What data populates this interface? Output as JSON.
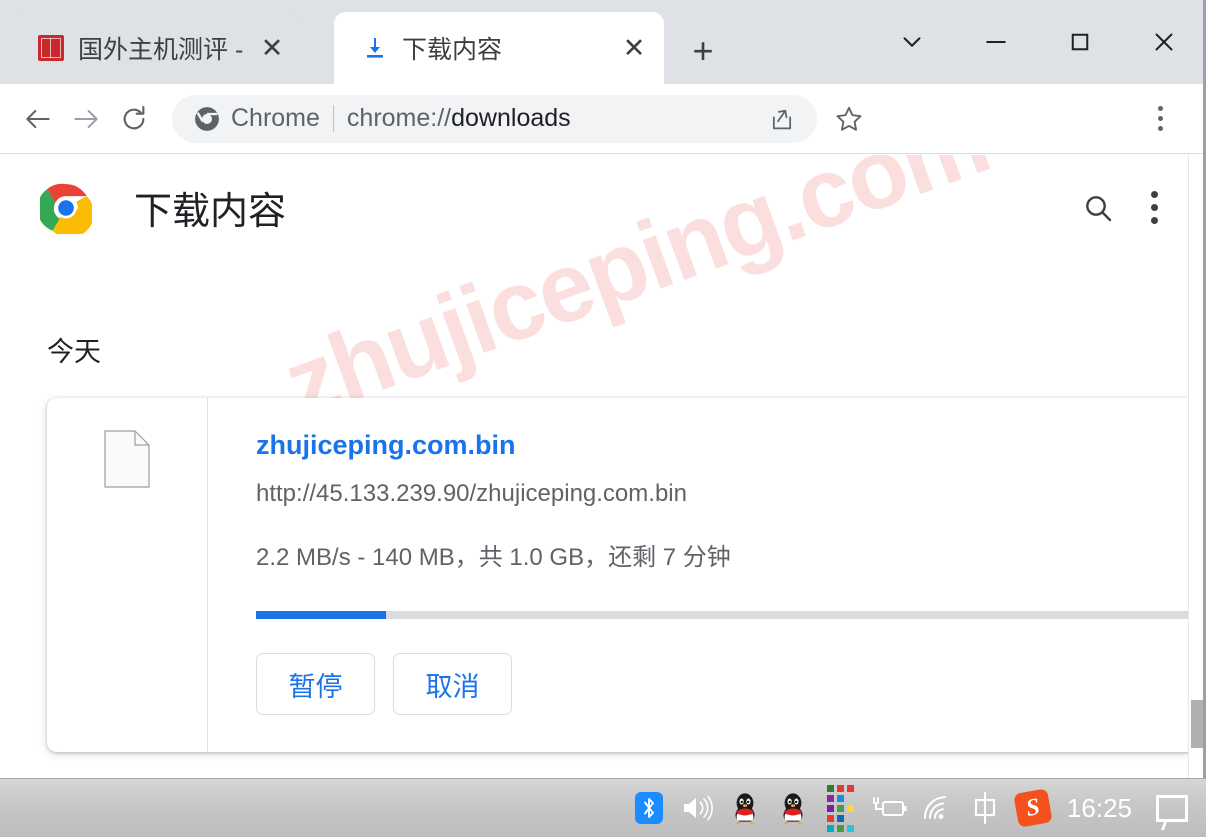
{
  "window": {
    "controls": [
      {
        "name": "tab-search",
        "glyph": "chevron-down"
      },
      {
        "name": "minimize",
        "glyph": "minimize"
      },
      {
        "name": "maximize",
        "glyph": "maximize"
      },
      {
        "name": "close",
        "glyph": "close"
      }
    ]
  },
  "tabs": [
    {
      "title": "国外主机测评 - 国",
      "favicon": "red-seal-favicon",
      "active": false,
      "close_label": "✕"
    },
    {
      "title": "下载内容",
      "favicon": "download-icon",
      "active": true,
      "close_label": "✕"
    }
  ],
  "new_tab_label": "+",
  "toolbar": {
    "back_icon": "arrow-left-icon",
    "forward_icon": "arrow-right-icon",
    "reload_icon": "reload-icon",
    "omnibox": {
      "scheme_label": "Chrome",
      "url_prefix": "chrome://",
      "url_path": "downloads",
      "share_icon": "share-icon"
    },
    "bookmark_icon": "star-icon",
    "menu_icon": "kebab-menu-icon"
  },
  "page": {
    "watermark": "zhujiceping.com",
    "header": {
      "title": "下载内容",
      "search_icon": "search-icon",
      "menu_icon": "kebab-menu-icon"
    },
    "section_label": "今天",
    "download": {
      "file_icon": "generic-file-icon",
      "file_name": "zhujiceping.com.bin",
      "url": "http://45.133.239.90/zhujiceping.com.bin",
      "status": "2.2 MB/s - 140 MB，共 1.0 GB，还剩 7 分钟",
      "speed": "2.2 MB/s",
      "downloaded": "140 MB",
      "total_size": "1.0 GB",
      "time_remaining": "7 分钟",
      "progress_percent": 13.8,
      "pause_label": "暂停",
      "cancel_label": "取消"
    }
  },
  "taskbar": {
    "clock": "16:25",
    "tray_items": [
      {
        "name": "bluetooth-icon"
      },
      {
        "name": "volume-icon"
      },
      {
        "name": "qq-icon"
      },
      {
        "name": "qq-icon-2"
      },
      {
        "name": "color-grid-icon"
      },
      {
        "name": "battery-charging-icon"
      },
      {
        "name": "wifi-icon"
      },
      {
        "name": "ime-chinese-icon",
        "label": "中"
      },
      {
        "name": "sogou-icon",
        "label": "S"
      }
    ],
    "action-center": "notification-icon"
  },
  "colors": {
    "accent_blue": "#1a73e8",
    "tabstrip_bg": "#dee1e6",
    "omnibox_bg": "#f1f3f4",
    "text_primary": "#202124",
    "text_secondary": "#5f6368",
    "watermark_pink": "#fbdede",
    "progress_track": "#dadce0"
  }
}
